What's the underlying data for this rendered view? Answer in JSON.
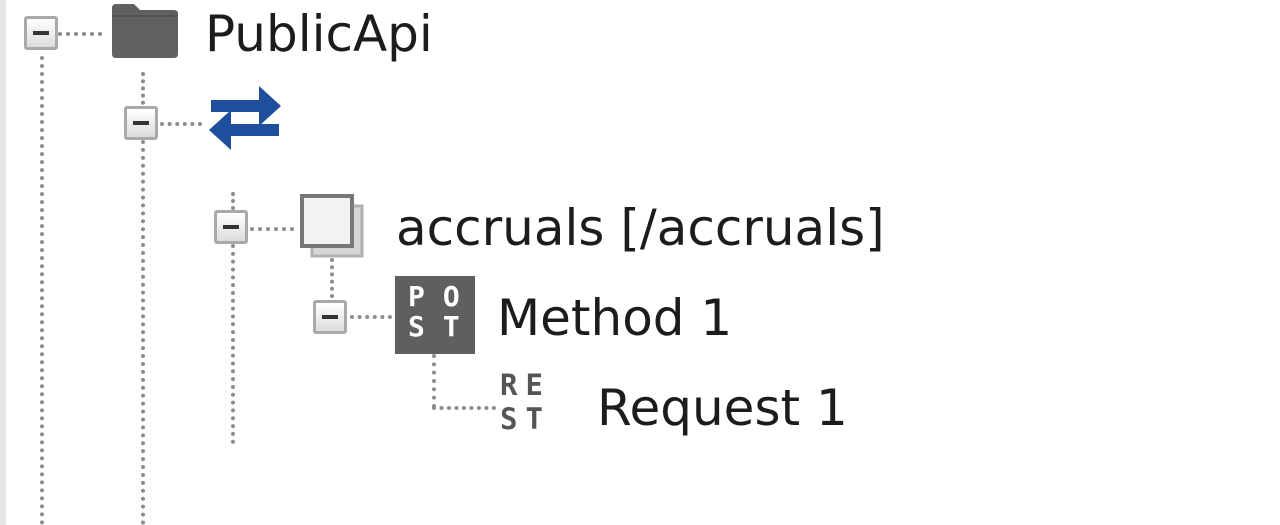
{
  "tree": {
    "root": {
      "label": "PublicApi",
      "icon": "folder-icon"
    },
    "interface": {
      "icon": "swap-arrows-icon",
      "icon_color": "#1f4e9c"
    },
    "resource": {
      "label": "accruals [/accruals]",
      "icon": "resource-icon"
    },
    "method": {
      "label": "Method 1",
      "icon": "post-method-icon",
      "badge_text": "POST"
    },
    "request": {
      "label": "Request 1",
      "icon": "rest-request-icon",
      "badge_text": "REST"
    }
  }
}
